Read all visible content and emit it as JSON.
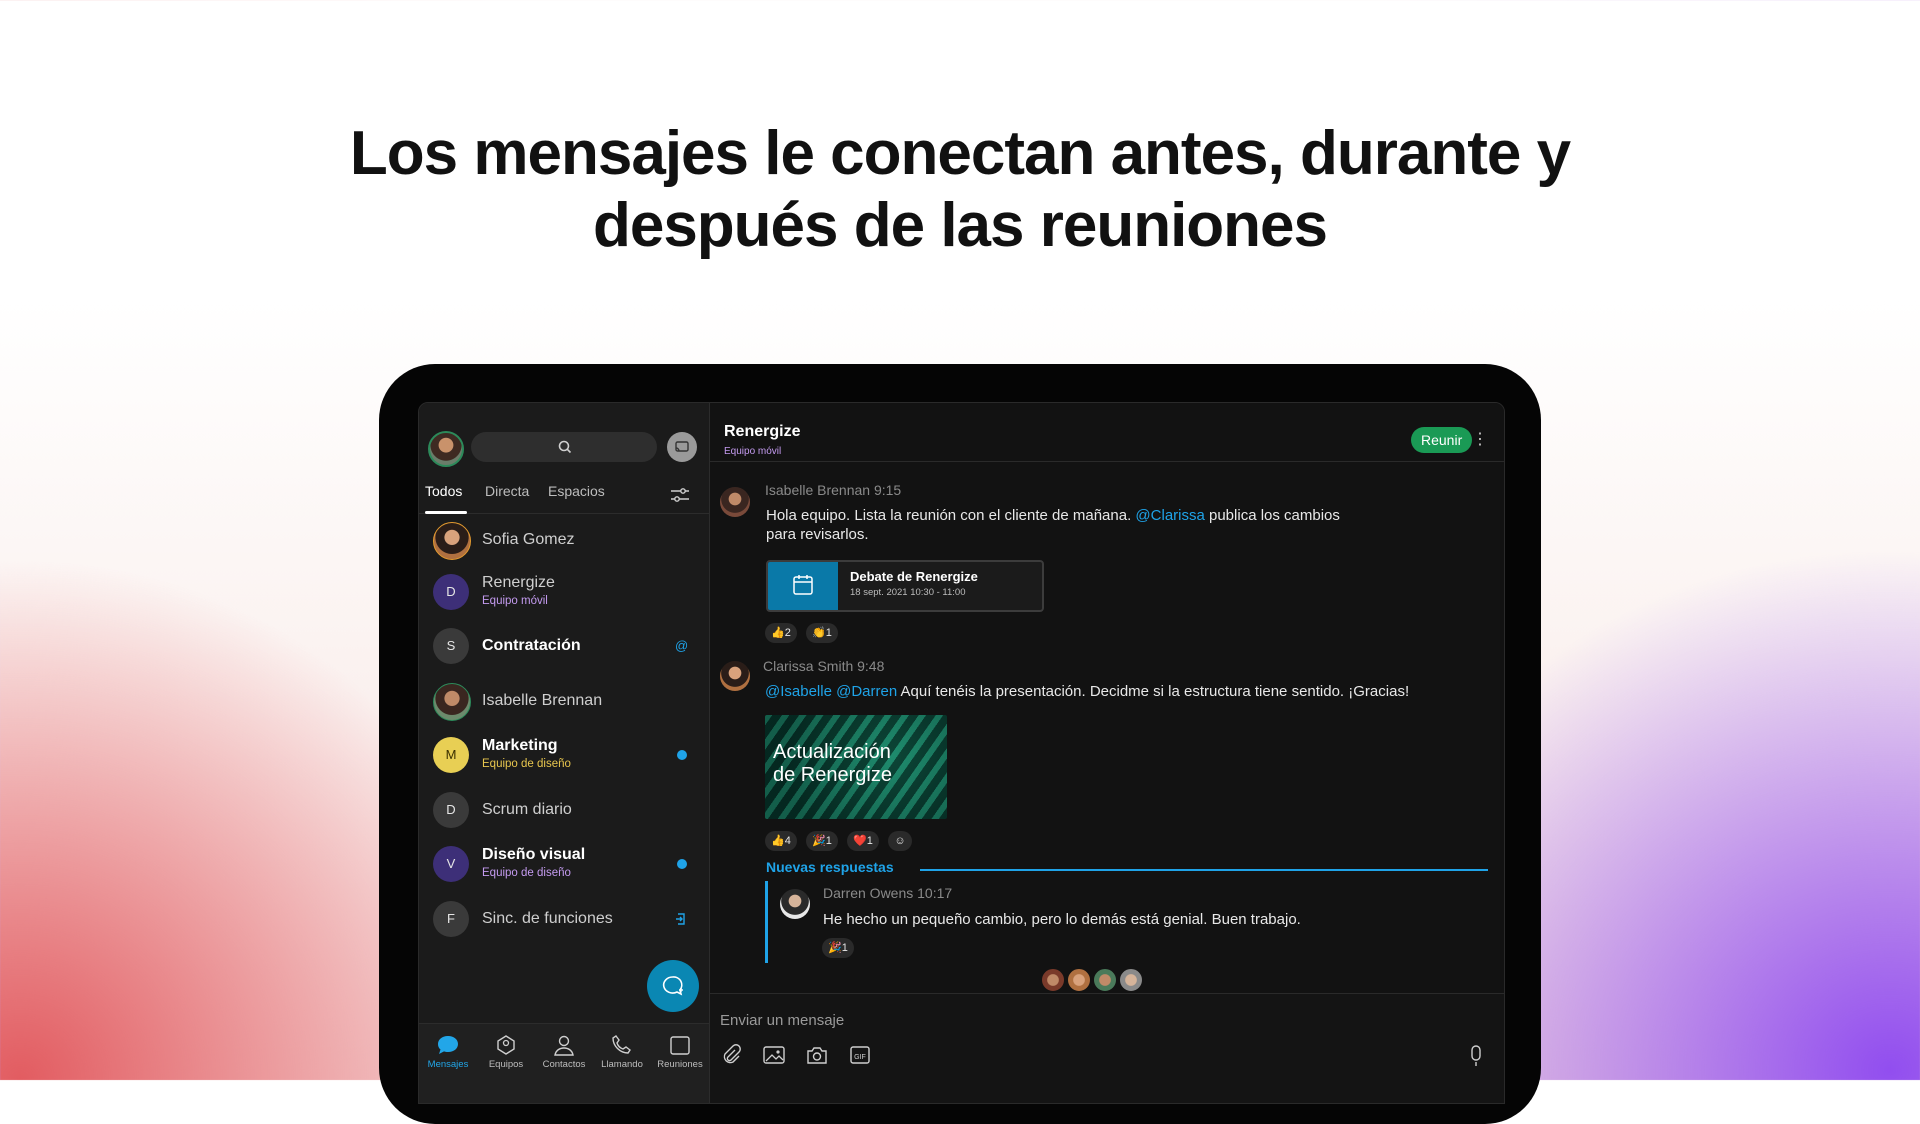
{
  "headline": {
    "line1": "Los mensajes le conectan antes, durante y",
    "line2": "después de las reuniones"
  },
  "sidebar": {
    "tabs": [
      "Todos",
      "Directa",
      "Espacios"
    ],
    "active_tab": "Todos",
    "spaces": [
      {
        "name": "Sofia Gomez",
        "subtitle": "",
        "avatar": "photo",
        "bold": false,
        "indicator": ""
      },
      {
        "name": "Renergize",
        "subtitle": "Equipo móvil",
        "avatar": "D",
        "avatar_color": "#3d2f78",
        "bold": false,
        "indicator": ""
      },
      {
        "name": "Contratación",
        "subtitle": "",
        "avatar": "S",
        "avatar_color": "#3a3a3a",
        "bold": true,
        "indicator": "@"
      },
      {
        "name": "Isabelle Brennan",
        "subtitle": "",
        "avatar": "photo",
        "bold": false,
        "indicator": ""
      },
      {
        "name": "Marketing",
        "subtitle": "Equipo de diseño",
        "avatar": "M",
        "avatar_color": "#e8cf54",
        "bold": true,
        "indicator": "dot"
      },
      {
        "name": "Scrum diario",
        "subtitle": "",
        "avatar": "D",
        "avatar_color": "#3a3a3a",
        "bold": false,
        "indicator": ""
      },
      {
        "name": "Diseño visual",
        "subtitle": "Equipo de diseño",
        "avatar": "V",
        "avatar_color": "#3d2f78",
        "bold": true,
        "indicator": "dot"
      },
      {
        "name": "Sinc. de funciones",
        "subtitle": "",
        "avatar": "F",
        "avatar_color": "#3a3a3a",
        "bold": false,
        "indicator": "sync"
      }
    ],
    "nav": [
      {
        "label": "Mensajes",
        "icon": "chat-bubble-icon",
        "active": true
      },
      {
        "label": "Equipos",
        "icon": "teams-icon",
        "active": false
      },
      {
        "label": "Contactos",
        "icon": "contact-icon",
        "active": false
      },
      {
        "label": "Llamando",
        "icon": "phone-icon",
        "active": false
      },
      {
        "label": "Reuniones",
        "icon": "calendar-icon",
        "active": false
      }
    ]
  },
  "space": {
    "title": "Renergize",
    "subtitle": "Equipo móvil",
    "meet_label": "Reunir"
  },
  "messages": {
    "m1": {
      "author_time": "Isabelle Brennan 9:15",
      "text_a": "Hola equipo. Lista la reunión con el cliente de mañana. ",
      "mention": "@Clarissa",
      "text_b": " publica los cambios",
      "text_c": "para revisarlos.",
      "card_title": "Debate de Renergize",
      "card_date": "18 sept. 2021 10:30 - 11:00",
      "reactions": [
        "👍2",
        "👏1"
      ]
    },
    "m2": {
      "author_time": "Clarissa Smith 9:48",
      "mention1": "@Isabelle",
      "mention2": "@Darren",
      "text": " Aquí tenéis la presentación. Decidme si la estructura tiene sentido. ¡Gracias!",
      "image_title_1": "Actualización",
      "image_title_2": "de Renergize",
      "reactions": [
        "👍4",
        "🎉1",
        "❤️1"
      ]
    },
    "new_replies": "Nuevas respuestas",
    "reply": {
      "author_time": "Darren Owens 10:17",
      "text": "He hecho un pequeño cambio, pero lo demás está genial. Buen trabajo.",
      "reactions": [
        "🎉1"
      ]
    }
  },
  "composer": {
    "placeholder": "Enviar un mensaje"
  },
  "colors": {
    "accent": "#1fa3e8",
    "meet_button": "#1a9a55",
    "team_label": "#c49bf0"
  }
}
